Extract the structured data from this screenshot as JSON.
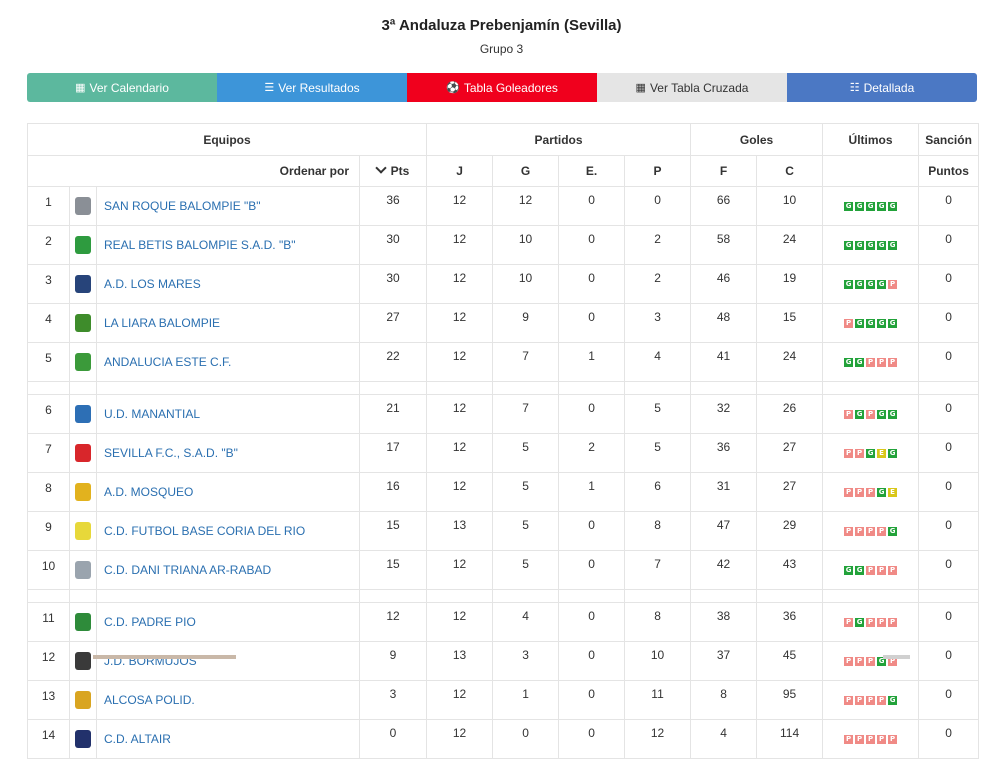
{
  "header": {
    "title": "3ª Andaluza Prebenjamín (Sevilla)",
    "subtitle": "Grupo 3"
  },
  "buttons": [
    {
      "label": "Ver Calendario",
      "icon": "calendar-icon",
      "color": "#5cb89e"
    },
    {
      "label": "Ver Resultados",
      "icon": "list-icon",
      "color": "#3d95d9"
    },
    {
      "label": "Tabla Goleadores",
      "icon": "soccer-ball-icon",
      "color": "#f0001d"
    },
    {
      "label": "Ver Tabla Cruzada",
      "icon": "table-icon",
      "color": "#e5e5e5"
    },
    {
      "label": "Detallada",
      "icon": "detail-list-icon",
      "color": "#4b78c4"
    }
  ],
  "table": {
    "groups": {
      "teams": "Equipos",
      "matches": "Partidos",
      "goals": "Goles",
      "last": "Últimos",
      "sanction": "Sanción"
    },
    "columns": {
      "sort_by": "Ordenar por",
      "pts": "Pts",
      "j": "J",
      "g": "G",
      "e": "E.",
      "p": "P",
      "f": "F",
      "c": "C",
      "points": "Puntos"
    },
    "rows": [
      {
        "pos": "1",
        "team": "SAN ROQUE BALOMPIE \"B\"",
        "crest": "#8a8f96",
        "pts": "36",
        "j": "12",
        "g": "12",
        "e": "0",
        "p": "0",
        "f": "66",
        "c": "10",
        "form": [
          "G",
          "G",
          "G",
          "G",
          "G"
        ],
        "sanction": "0"
      },
      {
        "pos": "2",
        "team": "REAL BETIS BALOMPIE S.A.D. \"B\"",
        "crest": "#2e9b3f",
        "pts": "30",
        "j": "12",
        "g": "10",
        "e": "0",
        "p": "2",
        "f": "58",
        "c": "24",
        "form": [
          "G",
          "G",
          "G",
          "G",
          "G"
        ],
        "sanction": "0"
      },
      {
        "pos": "3",
        "team": "A.D. LOS MARES",
        "crest": "#27447a",
        "pts": "30",
        "j": "12",
        "g": "10",
        "e": "0",
        "p": "2",
        "f": "46",
        "c": "19",
        "form": [
          "G",
          "G",
          "G",
          "G",
          "P"
        ],
        "sanction": "0"
      },
      {
        "pos": "4",
        "team": "LA LIARA BALOMPIE",
        "crest": "#3e8c2b",
        "pts": "27",
        "j": "12",
        "g": "9",
        "e": "0",
        "p": "3",
        "f": "48",
        "c": "15",
        "form": [
          "P",
          "G",
          "G",
          "G",
          "G"
        ],
        "sanction": "0"
      },
      {
        "pos": "5",
        "team": "ANDALUCIA ESTE C.F.",
        "crest": "#3b9a3a",
        "pts": "22",
        "j": "12",
        "g": "7",
        "e": "1",
        "p": "4",
        "f": "41",
        "c": "24",
        "form": [
          "G",
          "G",
          "P",
          "P",
          "P"
        ],
        "sanction": "0"
      },
      {
        "pos": "6",
        "team": "U.D. MANANTIAL",
        "crest": "#2d6fb5",
        "pts": "21",
        "j": "12",
        "g": "7",
        "e": "0",
        "p": "5",
        "f": "32",
        "c": "26",
        "form": [
          "P",
          "G",
          "P",
          "G",
          "G"
        ],
        "sanction": "0"
      },
      {
        "pos": "7",
        "team": "SEVILLA F.C., S.A.D. \"B\"",
        "crest": "#d8262b",
        "pts": "17",
        "j": "12",
        "g": "5",
        "e": "2",
        "p": "5",
        "f": "36",
        "c": "27",
        "form": [
          "P",
          "P",
          "G",
          "E",
          "G"
        ],
        "sanction": "0"
      },
      {
        "pos": "8",
        "team": "A.D. MOSQUEO",
        "crest": "#e2b21e",
        "pts": "16",
        "j": "12",
        "g": "5",
        "e": "1",
        "p": "6",
        "f": "31",
        "c": "27",
        "form": [
          "P",
          "P",
          "P",
          "G",
          "E"
        ],
        "sanction": "0"
      },
      {
        "pos": "9",
        "team": "C.D. FUTBOL BASE CORIA DEL RIO",
        "crest": "#e7d83a",
        "pts": "15",
        "j": "13",
        "g": "5",
        "e": "0",
        "p": "8",
        "f": "47",
        "c": "29",
        "form": [
          "P",
          "P",
          "P",
          "P",
          "G"
        ],
        "sanction": "0"
      },
      {
        "pos": "10",
        "team": "C.D. DANI TRIANA AR-RABAD",
        "crest": "#9aa4ae",
        "pts": "15",
        "j": "12",
        "g": "5",
        "e": "0",
        "p": "7",
        "f": "42",
        "c": "43",
        "form": [
          "G",
          "G",
          "P",
          "P",
          "P"
        ],
        "sanction": "0"
      },
      {
        "pos": "11",
        "team": "C.D. PADRE PIO",
        "crest": "#2e8b3a",
        "pts": "12",
        "j": "12",
        "g": "4",
        "e": "0",
        "p": "8",
        "f": "38",
        "c": "36",
        "form": [
          "P",
          "G",
          "P",
          "P",
          "P"
        ],
        "sanction": "0"
      },
      {
        "pos": "12",
        "team": "J.D. BORMUJOS",
        "crest": "#3a3a3a",
        "pts": "9",
        "j": "13",
        "g": "3",
        "e": "0",
        "p": "10",
        "f": "37",
        "c": "45",
        "form": [
          "P",
          "P",
          "P",
          "G",
          "P"
        ],
        "sanction": "0"
      },
      {
        "pos": "13",
        "team": "ALCOSA POLID.",
        "crest": "#d9a521",
        "pts": "3",
        "j": "12",
        "g": "1",
        "e": "0",
        "p": "11",
        "f": "8",
        "c": "95",
        "form": [
          "P",
          "P",
          "P",
          "P",
          "G"
        ],
        "sanction": "0"
      },
      {
        "pos": "14",
        "team": "C.D. ALTAIR",
        "crest": "#22316b",
        "pts": "0",
        "j": "12",
        "g": "0",
        "e": "0",
        "p": "12",
        "f": "4",
        "c": "114",
        "form": [
          "P",
          "P",
          "P",
          "P",
          "P"
        ],
        "sanction": "0"
      }
    ],
    "separators_after": [
      5,
      10
    ]
  }
}
